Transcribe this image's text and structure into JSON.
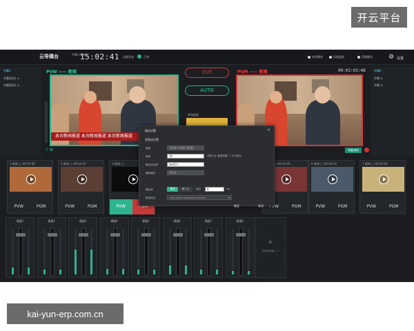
{
  "watermarks": {
    "top_right": "开云平台",
    "bottom_left": "kai-yun-erp.com.cn"
  },
  "header": {
    "title": "云导播台",
    "time_label": "TIME NOW",
    "clock": "15:02:41",
    "status_label": "设备状态",
    "status_value": "正常",
    "right_items": [
      "实时预览",
      "远程监控",
      "音频模式"
    ],
    "settings_label": "设置"
  },
  "left_panel": {
    "title": "字幕1",
    "items": [
      "字幕滚动1 ⊘",
      "字幕滚动2 ⊘"
    ]
  },
  "right_panel": {
    "title": "字幕2",
    "items": [
      "字幕 ⊘",
      "字幕 ⊘"
    ]
  },
  "monitors": {
    "pvw_label": "PVW —— 新闻",
    "pgm_label": "PGM —— 新闻",
    "pgm_timer": "00:02:03:48",
    "ticker": "本台新闻报道 本台新闻报道 本台新闻报道",
    "pgm_button": "导播/录制"
  },
  "switcher": {
    "cut": "CUT",
    "auto": "AUTO",
    "transition_label": "转场画面"
  },
  "dialog": {
    "title": "输出设置",
    "close": "×",
    "section": "直播流设置",
    "rows": [
      {
        "label": "画质",
        "value": "1920×1080 (超清)",
        "disabled": true
      },
      {
        "label": "码率",
        "value": "10",
        "disabled": false
      },
      {
        "label": "输出流名称",
        "value": "test13",
        "disabled": false
      },
      {
        "label": "编码格式",
        "value": "H264",
        "disabled": true
      }
    ],
    "bitrate_hint": "(单位:兆, 取值范围: 1-100兆比)",
    "output_label": "输出到",
    "output_active": "推流",
    "output_other": "第三方",
    "delay_label": "延迟",
    "delay_value": "0",
    "delay_unit": "ms",
    "url_label": "推流地址",
    "url_placeholder": "rtmp://push.example.com/live",
    "ok": "确定",
    "cancel": "取消"
  },
  "sources": [
    {
      "head": "1 新闻 ◯  00:03:46",
      "state": "",
      "pvw": "PVW",
      "pgm": "PGM",
      "thumb": "#b06a3a"
    },
    {
      "head": "2 新闻 ◯  00:04:42",
      "state": "",
      "pvw": "PVW",
      "pgm": "PGM",
      "thumb": "#5b3f35"
    },
    {
      "head": "3 新闻 ◯",
      "state": "active",
      "pvw": "PVW",
      "pgm": "PGM",
      "thumb": "#0c0c0c"
    },
    {
      "head": "",
      "state": "",
      "pvw": "",
      "pgm": "",
      "thumb": ""
    },
    {
      "head": "",
      "state": "",
      "pvw": "",
      "pgm": "",
      "thumb": ""
    },
    {
      "head": "5 新闻 ◯  00:01:45",
      "state": "",
      "pvw": "PVW",
      "pgm": "PGM",
      "thumb": "#7a3535"
    },
    {
      "head": "6 新闻 ◯  00:04:43",
      "state": "",
      "pvw": "PVW",
      "pgm": "PGM",
      "thumb": "#4a5a6a"
    },
    {
      "head": "7 新闻 ◯  00:03:45",
      "state": "",
      "pvw": "PVW",
      "pgm": "PGM",
      "thumb": "#c9b27a"
    }
  ],
  "mixer": {
    "channels": [
      "通道1",
      "通道2",
      "通道3",
      "通道4",
      "通道5",
      "通道6",
      "通道7",
      "通道8"
    ],
    "add_label": "添加音频输入 +"
  },
  "colors": {
    "accent": "#2fb38f",
    "pgm": "#d43a3a",
    "bg": "#1b1d21"
  }
}
